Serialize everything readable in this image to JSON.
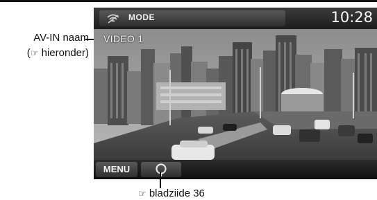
{
  "annotations": {
    "source_name_label": "AV-IN naam",
    "source_name_ref": "hieronder)",
    "paren_open": "(",
    "ref_symbol": "☞",
    "page_ref": "bladziide 36"
  },
  "screen": {
    "mode_label": "MODE",
    "clock": "10:28",
    "source_name": "VIDEO 1",
    "menu_label": "MENU",
    "icons": [
      "wireless-icon",
      "search-icon"
    ]
  }
}
